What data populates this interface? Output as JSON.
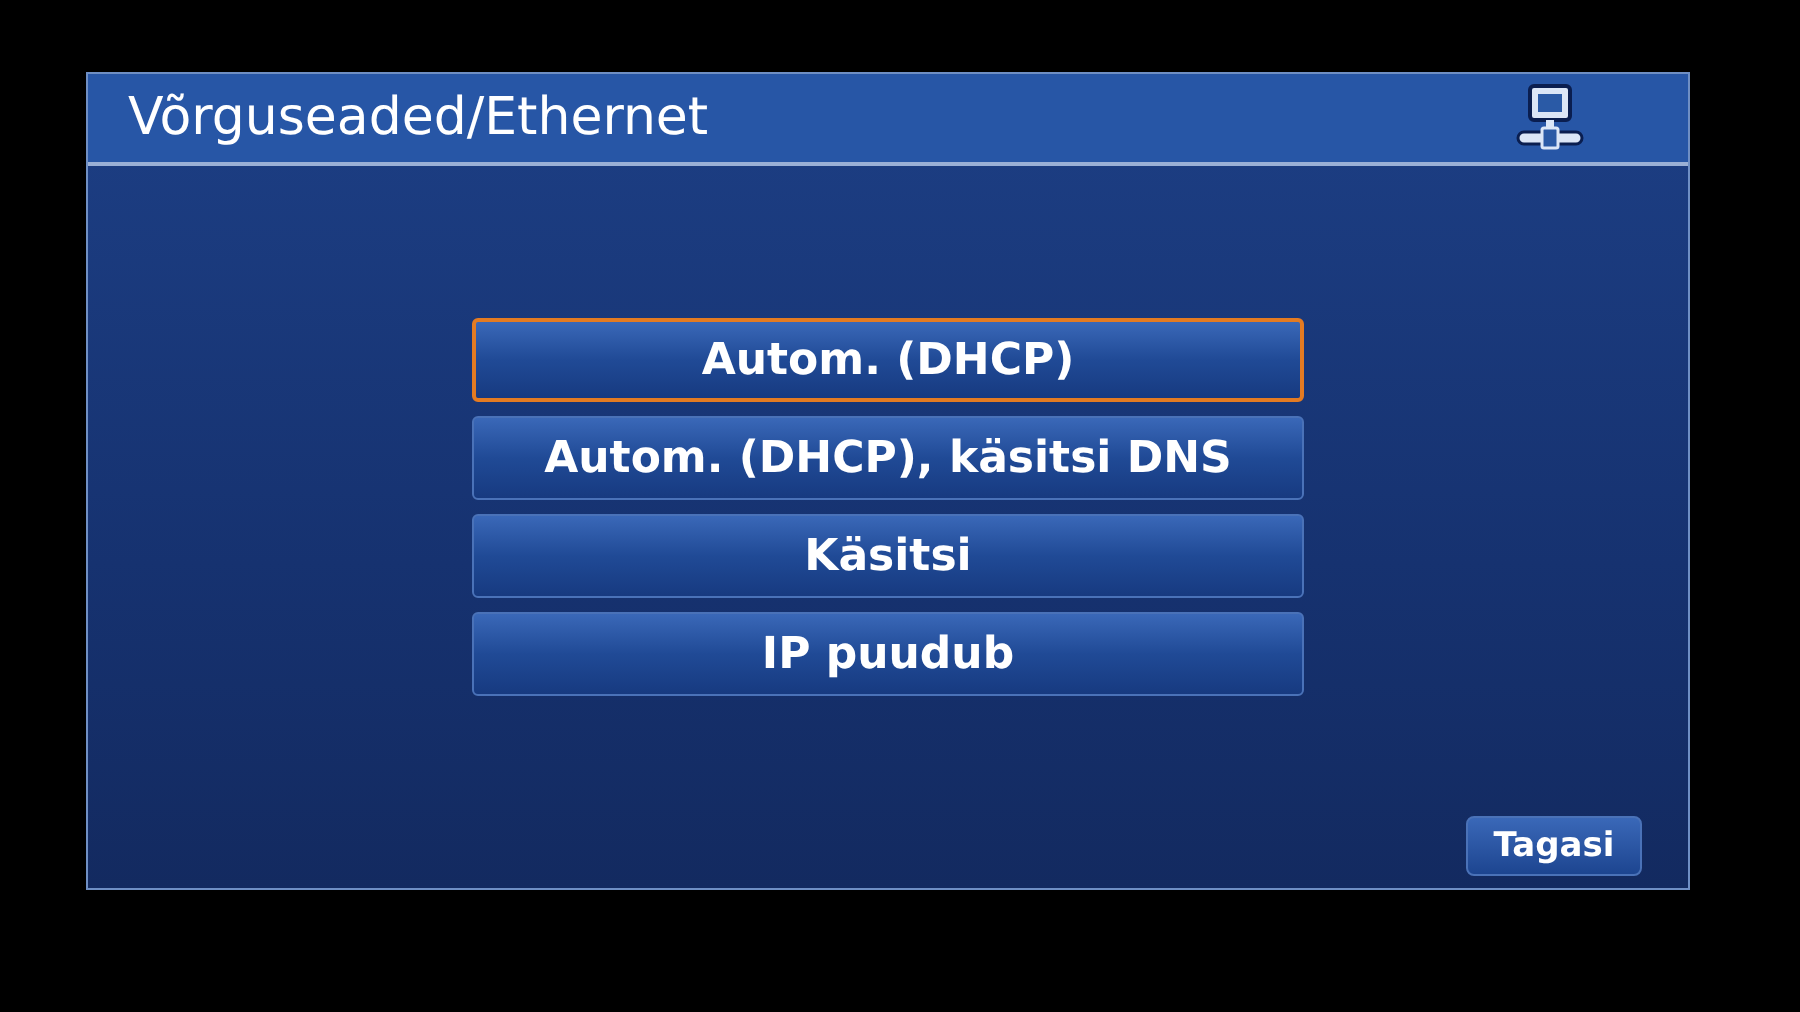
{
  "window": {
    "title": "Võrguseaded/Ethernet"
  },
  "options": [
    {
      "label": "Autom. (DHCP)",
      "selected": true
    },
    {
      "label": "Autom. (DHCP), käsitsi DNS",
      "selected": false
    },
    {
      "label": "Käsitsi",
      "selected": false
    },
    {
      "label": "IP puudub",
      "selected": false
    }
  ],
  "back_button": "Tagasi"
}
